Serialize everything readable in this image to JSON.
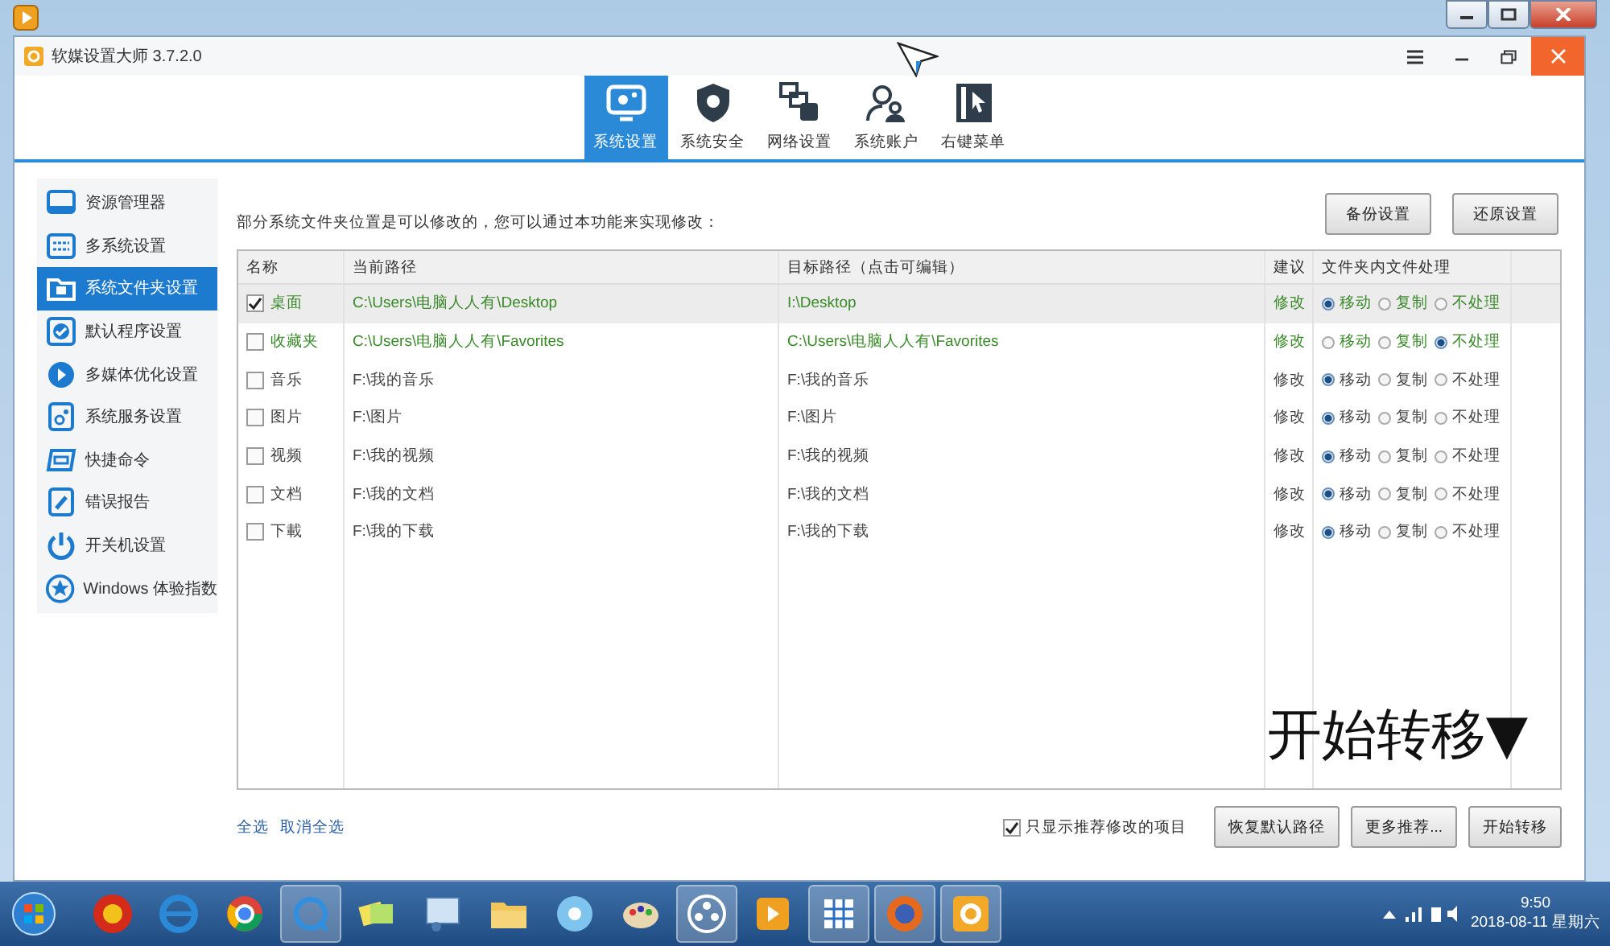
{
  "app": {
    "title": "软媒设置大师 3.7.2.0"
  },
  "tabs": [
    {
      "label": "系统设置",
      "selected": true
    },
    {
      "label": "系统安全",
      "selected": false
    },
    {
      "label": "网络设置",
      "selected": false
    },
    {
      "label": "系统账户",
      "selected": false
    },
    {
      "label": "右键菜单",
      "selected": false
    }
  ],
  "sidebar": {
    "items": [
      {
        "label": "资源管理器",
        "selected": false
      },
      {
        "label": "多系统设置",
        "selected": false
      },
      {
        "label": "系统文件夹设置",
        "selected": true
      },
      {
        "label": "默认程序设置",
        "selected": false
      },
      {
        "label": "多媒体优化设置",
        "selected": false
      },
      {
        "label": "系统服务设置",
        "selected": false
      },
      {
        "label": "快捷命令",
        "selected": false
      },
      {
        "label": "错误报告",
        "selected": false
      },
      {
        "label": "开关机设置",
        "selected": false
      },
      {
        "label": "Windows 体验指数",
        "selected": false
      }
    ]
  },
  "intro": "部分系统文件夹位置是可以修改的，您可以通过本功能来实现修改：",
  "top_buttons": [
    "备份设置",
    "还原设置"
  ],
  "table": {
    "columns": [
      "名称",
      "当前路径",
      "目标路径（点击可编辑）",
      "建议",
      "文件夹内文件处理"
    ],
    "rows": [
      {
        "selected": true,
        "checked": true,
        "recommended": true,
        "name": "桌面",
        "current_path": "C:\\Users\\电脑人人有\\Desktop",
        "target_path": "I:\\Desktop",
        "suggestion": "修改",
        "options": [
          {
            "label": "移动",
            "selected": true
          },
          {
            "label": "复制",
            "selected": false
          },
          {
            "label": "不处理",
            "selected": false
          }
        ]
      },
      {
        "selected": false,
        "checked": false,
        "recommended": true,
        "name": "收藏夹",
        "current_path": "C:\\Users\\电脑人人有\\Favorites",
        "target_path": "C:\\Users\\电脑人人有\\Favorites",
        "suggestion": "修改",
        "options": [
          {
            "label": "移动",
            "selected": false
          },
          {
            "label": "复制",
            "selected": false
          },
          {
            "label": "不处理",
            "selected": true
          }
        ]
      },
      {
        "selected": false,
        "checked": false,
        "recommended": false,
        "name": "音乐",
        "current_path": "F:\\我的音乐",
        "target_path": "F:\\我的音乐",
        "suggestion": "修改",
        "options": [
          {
            "label": "移动",
            "selected": true
          },
          {
            "label": "复制",
            "selected": false
          },
          {
            "label": "不处理",
            "selected": false
          }
        ]
      },
      {
        "selected": false,
        "checked": false,
        "recommended": false,
        "name": "图片",
        "current_path": "F:\\图片",
        "target_path": "F:\\图片",
        "suggestion": "修改",
        "options": [
          {
            "label": "移动",
            "selected": true
          },
          {
            "label": "复制",
            "selected": false
          },
          {
            "label": "不处理",
            "selected": false
          }
        ]
      },
      {
        "selected": false,
        "checked": false,
        "recommended": false,
        "name": "视频",
        "current_path": "F:\\我的视频",
        "target_path": "F:\\我的视频",
        "suggestion": "修改",
        "options": [
          {
            "label": "移动",
            "selected": true
          },
          {
            "label": "复制",
            "selected": false
          },
          {
            "label": "不处理",
            "selected": false
          }
        ]
      },
      {
        "selected": false,
        "checked": false,
        "recommended": false,
        "name": "文档",
        "current_path": "F:\\我的文档",
        "target_path": "F:\\我的文档",
        "suggestion": "修改",
        "options": [
          {
            "label": "移动",
            "selected": true
          },
          {
            "label": "复制",
            "selected": false
          },
          {
            "label": "不处理",
            "selected": false
          }
        ]
      },
      {
        "selected": false,
        "checked": false,
        "recommended": false,
        "name": "下載",
        "current_path": "F:\\我的下载",
        "target_path": "F:\\我的下载",
        "suggestion": "修改",
        "options": [
          {
            "label": "移动",
            "selected": true
          },
          {
            "label": "复制",
            "selected": false
          },
          {
            "label": "不处理",
            "selected": false
          }
        ]
      }
    ]
  },
  "annotation": "开始转移▼",
  "bottom": {
    "links": [
      "全选",
      "取消全选"
    ],
    "filter": {
      "label": "只显示推荐修改的项目",
      "checked": true
    },
    "buttons": [
      "恢复默认路径",
      "更多推荐...",
      "开始转移"
    ]
  },
  "taskbar": {
    "time": "9:50",
    "date": "2018-08-11 星期六"
  }
}
